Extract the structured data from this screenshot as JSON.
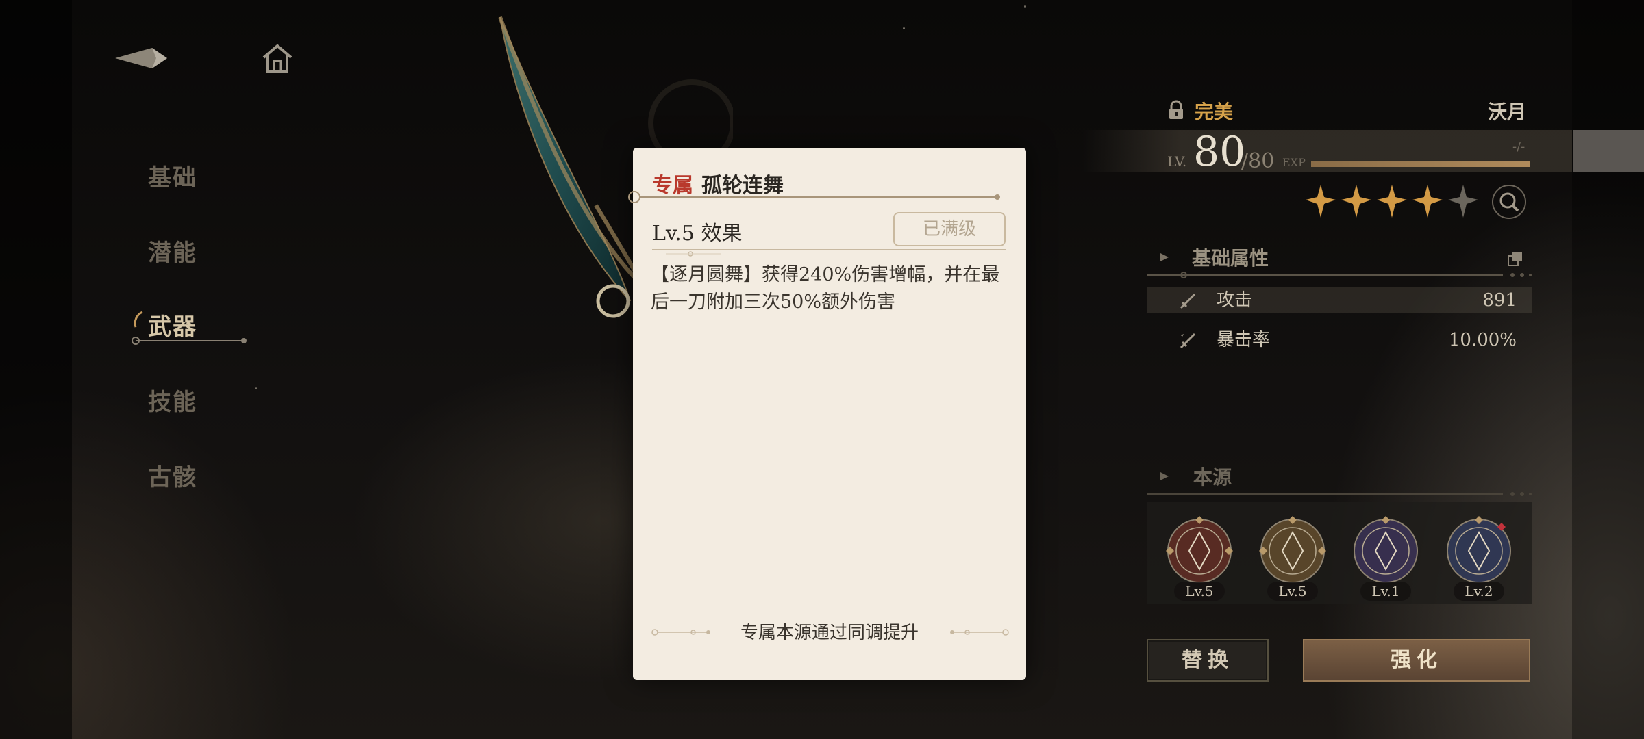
{
  "nav": {
    "back_icon": "back-arrow-icon",
    "home_icon": "home-icon"
  },
  "menu": {
    "items": [
      {
        "label": "基础",
        "active": false
      },
      {
        "label": "潜能",
        "active": false
      },
      {
        "label": "武器",
        "active": true
      },
      {
        "label": "技能",
        "active": false
      },
      {
        "label": "古骸",
        "active": false
      }
    ]
  },
  "popup": {
    "tag": "专属",
    "title": "孤轮连舞",
    "effect_title": "Lv.5 效果",
    "maxed_label": "已满级",
    "description": "【逐月圆舞】获得240%伤害增幅，并在最后一刀附加三次50%额外伤害",
    "footer": "专属本源通过同调提升"
  },
  "weapon": {
    "quality": "完美",
    "owner": "沃月",
    "level_prefix": "LV.",
    "level": "80",
    "level_max": "/80",
    "exp_label": "EXP",
    "exp_value": "-/-",
    "exp_fill": 1.0,
    "stars_filled": 4,
    "stars_total": 5,
    "colors": {
      "quality": "#d6a24a",
      "tag": "#b9392c",
      "star": "#d39a45"
    }
  },
  "base_stats": {
    "title": "基础属性",
    "rows": [
      {
        "name": "攻击",
        "value": "891"
      },
      {
        "name": "暴击率",
        "value": "10.00%"
      }
    ]
  },
  "origin": {
    "title": "本源",
    "items": [
      {
        "level": "Lv.5",
        "color": "#8b3b2e"
      },
      {
        "level": "Lv.5",
        "color": "#8b6a3a"
      },
      {
        "level": "Lv.1",
        "color": "#4c3f7a"
      },
      {
        "level": "Lv.2",
        "color": "#3d4a80"
      }
    ]
  },
  "buttons": {
    "replace": "替换",
    "enhance": "强化"
  }
}
